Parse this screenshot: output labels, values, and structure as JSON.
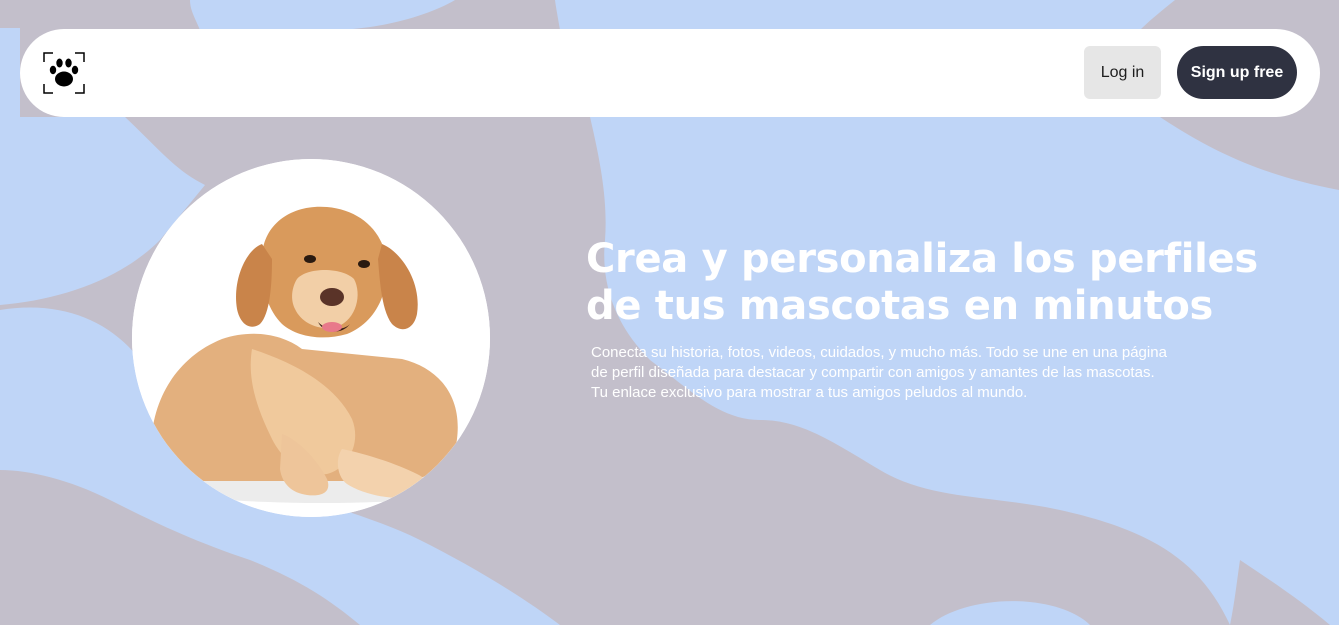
{
  "colors": {
    "background_blue": "#bfd5f7",
    "background_mauve": "#c3bfcb",
    "navbar_bg": "#ffffff",
    "login_bg": "#e6e6e6",
    "signup_bg": "#2f3241",
    "hero_text": "#ffffff"
  },
  "navbar": {
    "logo_icon": "paw-print-icon",
    "login_label": "Log in",
    "signup_label": "Sign up free"
  },
  "hero": {
    "image_subject": "golden-retriever-photo",
    "headline": "Crea y personaliza los perfiles de tus mascotas en minutos",
    "description_lines": [
      "Conecta su historia, fotos, videos, cuidados, y mucho más. Todo se une en una página",
      "de perfil diseñada para destacar y compartir con amigos y amantes de las mascotas.",
      "Tu enlace exclusivo para mostrar a tus amigos peludos al mundo."
    ]
  }
}
